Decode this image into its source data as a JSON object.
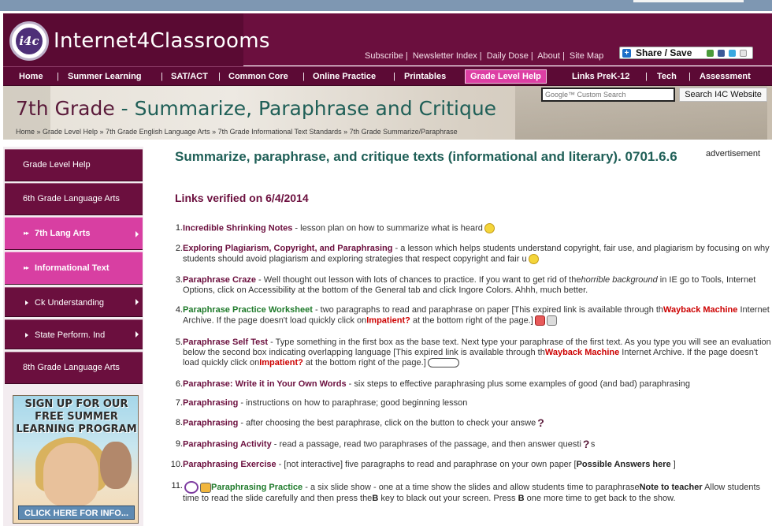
{
  "site": {
    "logo_badge": "i4c",
    "logo_text": "Internet4Classrooms",
    "util_links": [
      "Subscribe",
      "Newsletter Index",
      "Daily Dose",
      "About",
      "Site Map"
    ],
    "share_label": "Share / Save"
  },
  "nav": {
    "items": [
      "Home",
      "Summer Learning",
      "SAT/ACT",
      "Common Core",
      "Online Practice",
      "Printables",
      "Grade Level Help",
      "Links PreK-12",
      "Tech",
      "Assessment"
    ],
    "active": "Grade Level Help"
  },
  "hero": {
    "title_grade": "7th Grade",
    "title_rest": " - Summarize, Paraphrase and Critique",
    "breadcrumb": "Home » Grade Level Help » 7th Grade English Language Arts » 7th Grade Informational Text Standards » 7th Grade Summarize/Paraphrase",
    "search_placeholder": "Google™ Custom Search",
    "search_button": "Search I4C Website"
  },
  "sidebar": {
    "items": [
      {
        "label": "Grade Level Help",
        "style": "dark",
        "marker": "none"
      },
      {
        "label": "6th Grade Language Arts",
        "style": "dark",
        "marker": "none"
      },
      {
        "label": "7th Lang Arts",
        "style": "pink",
        "marker": "double"
      },
      {
        "label": "Informational Text",
        "style": "pink",
        "marker": "double"
      },
      {
        "label": "Ck Understanding",
        "style": "dark",
        "marker": "single"
      },
      {
        "label": "State Perform. Ind",
        "style": "dark",
        "marker": "single"
      },
      {
        "label": "8th Grade Language Arts",
        "style": "dark",
        "marker": "none"
      }
    ],
    "promo_head": "SIGN UP FOR OUR FREE SUMMER LEARNING PROGRAM",
    "promo_foot": "CLICK HERE FOR INFO..."
  },
  "main": {
    "heading": "Summarize, paraphrase, and critique texts (informational and literary). 0701.6.6",
    "verified": "Links verified on 6/4/2014",
    "advert": "advertisement",
    "items": [
      {
        "num": "1.",
        "title": "Incredible Shrinking Notes",
        "desc": " - lesson plan on how to summarize what is heard"
      },
      {
        "num": "2.",
        "title": "Exploring Plagiarism, Copyright, and Paraphrasing",
        "desc": "  - a lesson which helps students understand copyright, fair use, and plagiarism by focusing on why students should avoid plagiarism and exploring strategies that respect copyright and fair u"
      },
      {
        "num": "3.",
        "title": "Paraphrase Craze",
        "desc": " - Well thought out lesson with lots of chances to practice. If you want to get rid of the",
        "desc_ital": "horrible background",
        "desc2": " in IE go to Tools, Internet Options, click on Accessibility at the bottom of the General tab and click Ingore Colors. Ahhh, much better."
      },
      {
        "num": "4.",
        "title": "Paraphrase Practice Worksheet",
        "desc": " - two paragraphs to read and paraphrase on paper [This expired link is available through th",
        "red1": "Wayback Machine",
        "desc2": " Internet Archive. If the page doesn't load quickly click on",
        "red2": "Impatient?",
        "desc3": "  at the bottom right of the page.]"
      },
      {
        "num": "5.",
        "title": "Paraphrase Self Test",
        "desc": " - Type something in the first box as the base text. Next type your paraphrase of the first text. As you type you will see an evaluation below the second box indicating overlapping language [This expired link is available through th",
        "red1": "Wayback Machine",
        "desc2": " Internet Archive. If the page doesn't load quickly click on",
        "red2": "Impatient?",
        "desc3": "  at the bottom right of the page.]"
      },
      {
        "num": "6.",
        "title": "Paraphrase: Write it in Your Own Words",
        "desc": "  - six steps to effective paraphrasing plus some examples of good (and bad) paraphrasing"
      },
      {
        "num": "7.",
        "title": "Paraphrasing",
        "desc": " - instructions on how to paraphrase; good beginning lesson"
      },
      {
        "num": "8.",
        "title": "Paraphrasing",
        "desc": "  - after choosing the best paraphrase, click on the button to check your answe"
      },
      {
        "num": "9.",
        "title": "Paraphrasing Activity",
        "desc": "  - read a passage, read two paraphrases of the passage, and then answer questi",
        "desc_tail": "s"
      },
      {
        "num": "10.",
        "title": "Paraphrasing Exercise",
        "desc": " - [not interactive] five paragraphs to read and paraphrase on your own paper [",
        "blk": "Possible Answers here",
        "desc2": " ]"
      },
      {
        "num": "11.",
        "title": "Paraphrasing Practice",
        "desc": "  - a six slide show - one at a time show the slides and allow students time to paraphrase",
        "blk": "Note to teacher",
        "desc2": " Allow students time to read the slide carefully and then press the",
        "blk2": "B",
        "desc3": " key to black out your screen. Press ",
        "blk3": "B",
        "desc4": " one more time to get back to the show."
      }
    ]
  }
}
